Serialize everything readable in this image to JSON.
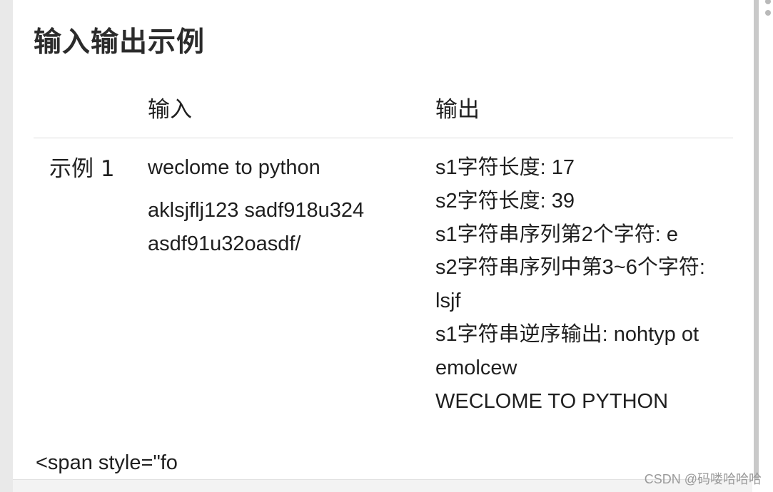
{
  "heading": "输入输出示例",
  "table": {
    "headers": {
      "input": "输入",
      "output": "输出"
    },
    "rows": [
      {
        "label": "示例 1",
        "input_lines": [
          "weclome to python",
          "aklsjflj123 sadf918u324",
          "asdf91u32oasdf/"
        ],
        "output_lines": [
          "s1字符长度: 17",
          "s2字符长度: 39",
          "s1字符串序列第2个字符: e",
          "s2字符串序列中第3~6个字符:",
          "lsjf",
          "s1字符串逆序输出: nohtyp ot",
          "emolcew",
          "WECLOME TO PYTHON"
        ]
      }
    ]
  },
  "code_fragment": "<span style=\"fo",
  "watermark": "CSDN @码喽哈哈哈"
}
